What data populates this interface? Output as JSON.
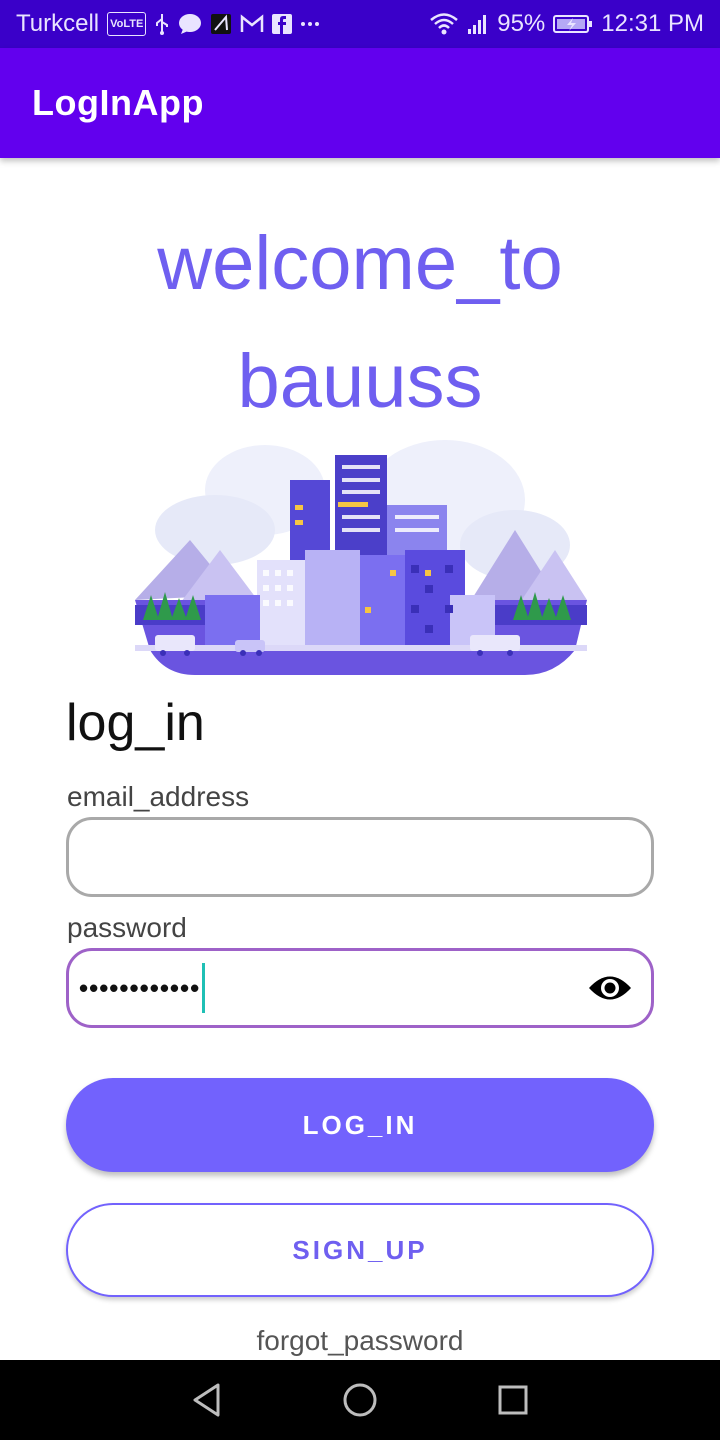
{
  "status_bar": {
    "carrier": "Turkcell",
    "volte_badge": "VoLTE",
    "battery_percent": "95%",
    "time": "12:31 PM",
    "icons": [
      "volte-icon",
      "usb-icon",
      "message-icon",
      "app-icon",
      "gmail-icon",
      "facebook-icon",
      "more-icon",
      "wifi-icon",
      "signal-icon",
      "battery-charging-icon"
    ]
  },
  "app_bar": {
    "title": "LogInApp"
  },
  "welcome": {
    "line1": "welcome_to",
    "line2": "bauuss"
  },
  "login": {
    "heading": "log_in",
    "email_label": "email_address",
    "email_value": "",
    "password_label": "password",
    "password_value": "••••••••••••",
    "login_button": "LOG_IN",
    "signup_button": "SIGN_UP",
    "forgot_password": "forgot_password"
  },
  "colors": {
    "status_bar": "#3a00c9",
    "app_bar": "#6200ee",
    "accent": "#7262fd",
    "welcome_text": "#6f5ff0",
    "password_border": "#9e62c8",
    "caret": "#1fc0b5"
  },
  "nav_bar": {
    "buttons": [
      "back-icon",
      "home-icon",
      "recents-icon"
    ]
  }
}
